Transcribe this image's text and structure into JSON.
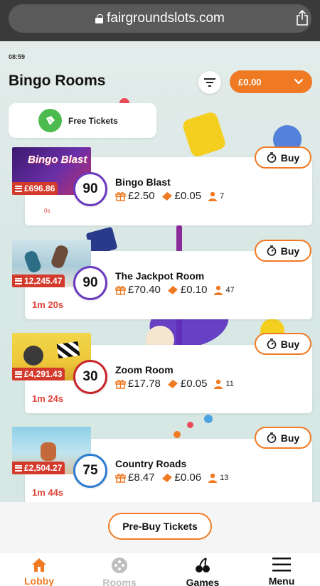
{
  "browser": {
    "url": "fairgroundslots.com"
  },
  "status": {
    "time": "08:59"
  },
  "header": {
    "title": "Bingo Rooms",
    "balance": "£0.00"
  },
  "free_tickets": {
    "label": "Free Tickets"
  },
  "rooms": [
    {
      "name": "Bingo Blast",
      "ball": "90",
      "jackpot": "£696.86",
      "prize": "£2.50",
      "ticket_price": "£0.05",
      "players": "7",
      "timer": "0s",
      "buy_label": "Buy",
      "thumb_text": "Bingo Blast"
    },
    {
      "name": "The Jackpot Room",
      "ball": "90",
      "jackpot": "12,245.47",
      "prize": "£70.40",
      "ticket_price": "£0.10",
      "players": "47",
      "timer": "1m 20s",
      "buy_label": "Buy"
    },
    {
      "name": "Zoom Room",
      "ball": "30",
      "jackpot": "£4,291.43",
      "prize": "£17.78",
      "ticket_price": "£0.05",
      "players": "11",
      "timer": "1m 24s",
      "buy_label": "Buy"
    },
    {
      "name": "Country Roads",
      "ball": "75",
      "jackpot": "£2,504.27",
      "prize": "£8.47",
      "ticket_price": "£0.06",
      "players": "13",
      "timer": "1m 44s",
      "buy_label": "Buy"
    }
  ],
  "prebuy": {
    "label": "Pre-Buy Tickets"
  },
  "nav": [
    {
      "label": "Lobby",
      "icon": "house-icon",
      "active": true
    },
    {
      "label": "Rooms",
      "icon": "bingo-ball-icon",
      "active": false
    },
    {
      "label": "Games",
      "icon": "cherries-icon",
      "active": false
    },
    {
      "label": "Menu",
      "icon": "hamburger-icon",
      "active": false
    }
  ],
  "colors": {
    "accent": "#f07a24",
    "jackpot_red": "#d33a2c",
    "timer_red": "#e0463a",
    "green": "#4cbb4f",
    "ball_90": "#6a3bbf",
    "ball_30": "#c8252b",
    "ball_75": "#2e7dd1"
  }
}
